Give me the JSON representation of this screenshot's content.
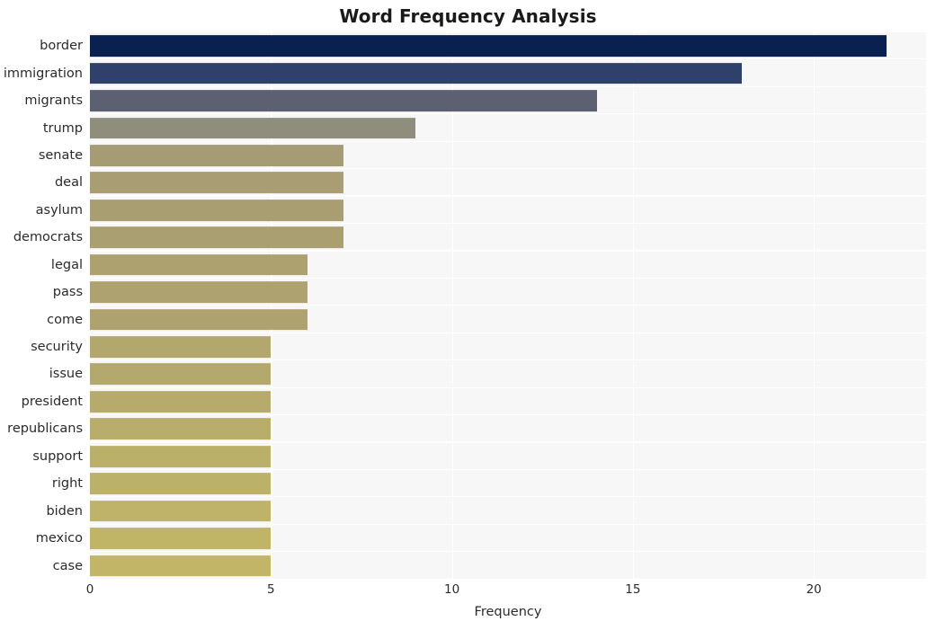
{
  "chart_data": {
    "type": "bar",
    "orientation": "horizontal",
    "title": "Word Frequency Analysis",
    "xlabel": "Frequency",
    "ylabel": "",
    "xlim": [
      0,
      23.1
    ],
    "ylim": [
      0,
      20
    ],
    "grid": true,
    "legend": null,
    "categories": [
      "border",
      "immigration",
      "migrants",
      "trump",
      "senate",
      "deal",
      "asylum",
      "democrats",
      "legal",
      "pass",
      "come",
      "security",
      "issue",
      "president",
      "republicans",
      "support",
      "right",
      "biden",
      "mexico",
      "case"
    ],
    "values": [
      22,
      18,
      14,
      9,
      7,
      7,
      7,
      7,
      6,
      6,
      6,
      5,
      5,
      5,
      5,
      5,
      5,
      5,
      5,
      5
    ],
    "bar_colors": [
      "#0a2050",
      "#2f406b",
      "#5c6070",
      "#8f8d7b",
      "#a59b74",
      "#a89d73",
      "#a99e72",
      "#aa9f71",
      "#ac a16f",
      "#ada270",
      "#aea36f",
      "#b2a76d",
      "#b4a96c",
      "#b6ab6b",
      "#b8ad6a",
      "#bab069",
      "#bcb168",
      "#beb368",
      "#c0b467",
      "#c2b567"
    ],
    "xticks": [
      0,
      5,
      10,
      15,
      20
    ],
    "xtick_labels": [
      "0",
      "5",
      "10",
      "15",
      "20"
    ],
    "style": {
      "plot_background": "#f7f7f7",
      "figure_background": "#ffffff",
      "gridline_color": "#ffffff",
      "text_color": "#2b2b2b",
      "title_color": "#1a1a1a"
    }
  }
}
